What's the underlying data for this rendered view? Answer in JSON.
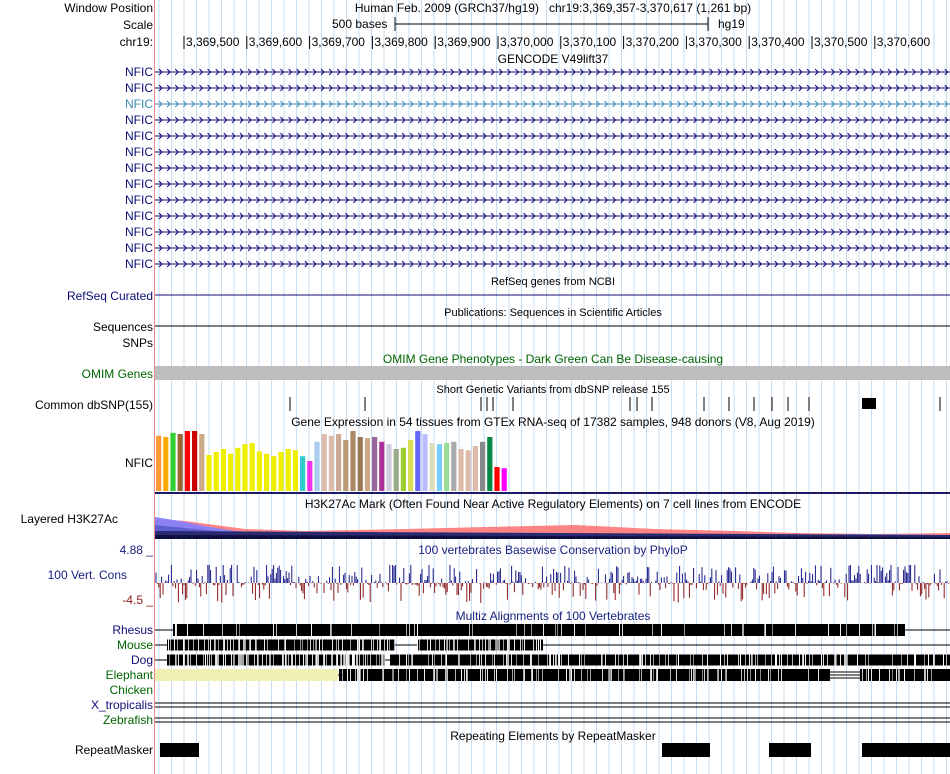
{
  "header": {
    "window_position_label": "Window Position",
    "scale_label": "Scale",
    "chrom_label": "chr19:",
    "assembly_text": "Human Feb. 2009 (GRCh37/hg19)",
    "position_text": "chr19:3,369,357-3,370,617 (1,261 bp)",
    "scale_text": "500 bases",
    "db_text": "hg19",
    "ticks": [
      "3,369,500",
      "3,369,600",
      "3,369,700",
      "3,369,800",
      "3,369,900",
      "3,370,000",
      "3,370,100",
      "3,370,200",
      "3,370,300",
      "3,370,400",
      "3,370,500",
      "3,370,600"
    ]
  },
  "gencode": {
    "title": "GENCODE V49lift37",
    "transcripts": [
      "NFIC",
      "NFIC",
      "NFIC",
      "NFIC",
      "NFIC",
      "NFIC",
      "NFIC",
      "NFIC",
      "NFIC",
      "NFIC",
      "NFIC",
      "NFIC",
      "NFIC"
    ],
    "highlighted_index": 2,
    "color": "#0c0c78",
    "highlight_color": "#3c8cb4"
  },
  "refseq": {
    "title": "RefSeq genes from NCBI",
    "label": "RefSeq Curated",
    "color": "#0c0c78"
  },
  "publications": {
    "title": "Publications: Sequences in Scientific Articles",
    "label": "Sequences"
  },
  "snps_label": "SNPs",
  "omim": {
    "title": "OMIM Gene Phenotypes - Dark Green Can Be Disease-causing",
    "label": "OMIM Genes",
    "color": "#006400",
    "bar_color": "#bebebe"
  },
  "dbsnp": {
    "title": "Short Genetic Variants from dbSNP release 155",
    "label": "Common dbSNP(155)"
  },
  "gtex": {
    "title": "Gene Expression in 54 tissues from GTEx RNA-seq of 17382 samples, 948 donors (V8, Aug 2019)",
    "label": "NFIC",
    "bars": [
      {
        "v": 0.92,
        "c": "#ff9933"
      },
      {
        "v": 0.9,
        "c": "#ffaa00"
      },
      {
        "v": 0.97,
        "c": "#33cc33"
      },
      {
        "v": 0.95,
        "c": "#996633"
      },
      {
        "v": 1.0,
        "c": "#ff0000"
      },
      {
        "v": 1.0,
        "c": "#cc0000"
      },
      {
        "v": 0.95,
        "c": "#ccaa88"
      },
      {
        "v": 0.6,
        "c": "#eeee00"
      },
      {
        "v": 0.65,
        "c": "#eeee00"
      },
      {
        "v": 0.7,
        "c": "#eeee00"
      },
      {
        "v": 0.62,
        "c": "#eeee00"
      },
      {
        "v": 0.72,
        "c": "#eeee00"
      },
      {
        "v": 0.78,
        "c": "#eeee00"
      },
      {
        "v": 0.8,
        "c": "#eeee00"
      },
      {
        "v": 0.66,
        "c": "#eeee00"
      },
      {
        "v": 0.62,
        "c": "#eeee00"
      },
      {
        "v": 0.58,
        "c": "#eeee00"
      },
      {
        "v": 0.65,
        "c": "#eeee00"
      },
      {
        "v": 0.7,
        "c": "#eeee00"
      },
      {
        "v": 0.68,
        "c": "#eeee00"
      },
      {
        "v": 0.58,
        "c": "#33cccc"
      },
      {
        "v": 0.5,
        "c": "#ee33ee"
      },
      {
        "v": 0.82,
        "c": "#aaccee"
      },
      {
        "v": 0.95,
        "c": "#ddbbaa"
      },
      {
        "v": 0.92,
        "c": "#ddbbaa"
      },
      {
        "v": 0.95,
        "c": "#ccaa99"
      },
      {
        "v": 0.85,
        "c": "#bb9977"
      },
      {
        "v": 1.0,
        "c": "#aa8866"
      },
      {
        "v": 0.9,
        "c": "#997755"
      },
      {
        "v": 0.88,
        "c": "#ccaa88"
      },
      {
        "v": 0.9,
        "c": "#996699"
      },
      {
        "v": 0.82,
        "c": "#aa3399"
      },
      {
        "v": 0.78,
        "c": "#ccccdd"
      },
      {
        "v": 0.7,
        "c": "#99aa88"
      },
      {
        "v": 0.72,
        "c": "#99cc33"
      },
      {
        "v": 0.85,
        "c": "#dddd55"
      },
      {
        "v": 1.0,
        "c": "#6666ff"
      },
      {
        "v": 0.95,
        "c": "#bbbbff"
      },
      {
        "v": 0.8,
        "c": "#ddddbb"
      },
      {
        "v": 0.78,
        "c": "#77ccff"
      },
      {
        "v": 0.8,
        "c": "#99dd99"
      },
      {
        "v": 0.82,
        "c": "#aaaaaa"
      },
      {
        "v": 0.7,
        "c": "#ddbbaa"
      },
      {
        "v": 0.68,
        "c": "#ddbbaa"
      },
      {
        "v": 0.75,
        "c": "#ddbbaa"
      },
      {
        "v": 0.82,
        "c": "#888888"
      },
      {
        "v": 0.9,
        "c": "#008844"
      },
      {
        "v": 0.4,
        "c": "#ff0000"
      },
      {
        "v": 0.38,
        "c": "#ff00ff"
      }
    ]
  },
  "h3k27ac": {
    "title": "H3K27Ac Mark (Often Found Near Active Regulatory Elements) on 7 cell lines from ENCODE",
    "label": "Layered H3K27Ac"
  },
  "conservation": {
    "title": "100 vertebrates Basewise Conservation by PhyloP",
    "label": "100 Vert. Cons",
    "max_label": "4.88 _",
    "min_label": "-4.5 _",
    "color": "#1a2080",
    "pos_color": "#1a1a88",
    "neg_color": "#881a1a"
  },
  "multiz": {
    "title": "Multiz Alignments of 100 Vertebrates",
    "species": [
      "Rhesus",
      "Mouse",
      "Dog",
      "Elephant",
      "Chicken",
      "X_tropicalis",
      "Zebrafish"
    ],
    "species_colors": [
      "#0c0c78",
      "#006400",
      "#0c0c78",
      "#006400",
      "#006400",
      "#0c0c78",
      "#006400"
    ]
  },
  "repeatmasker": {
    "title": "Repeating Elements by RepeatMasker",
    "label": "RepeatMasker"
  }
}
